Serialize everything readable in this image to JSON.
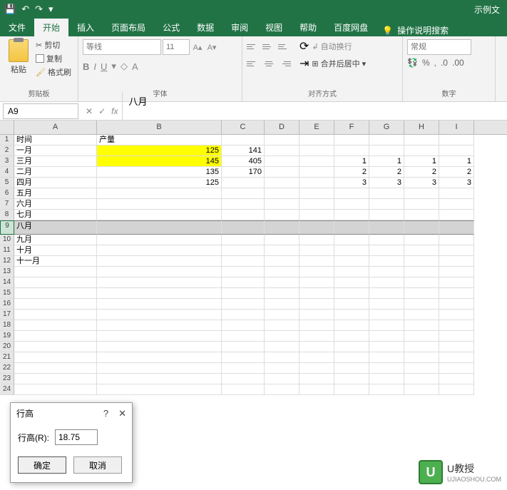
{
  "titlebar": {
    "title": "示例文"
  },
  "tabs": {
    "file": "文件",
    "home": "开始",
    "insert": "插入",
    "layout": "页面布局",
    "formulas": "公式",
    "data": "数据",
    "review": "审阅",
    "view": "视图",
    "help": "帮助",
    "baidu": "百度网盘",
    "tellme": "操作说明搜索"
  },
  "ribbon": {
    "clipboard": {
      "paste": "粘贴",
      "cut": "剪切",
      "copy": "复制",
      "format_painter": "格式刷",
      "label": "剪贴板"
    },
    "font": {
      "name_placeholder": "等线",
      "size_placeholder": "11",
      "label": "字体"
    },
    "align": {
      "wrap": "自动换行",
      "merge": "合并后居中",
      "label": "对齐方式"
    },
    "number": {
      "format": "常规",
      "label": "数字"
    }
  },
  "namebox": "A9",
  "formula_value": "八月",
  "columns": [
    "A",
    "B",
    "C",
    "D",
    "E",
    "F",
    "G",
    "H",
    "I"
  ],
  "rows": [
    {
      "n": 1,
      "A": "时间",
      "B": "产量"
    },
    {
      "n": 2,
      "A": "一月",
      "B": "125",
      "C": "141",
      "yellow": true
    },
    {
      "n": 3,
      "A": "三月",
      "B": "145",
      "C": "405",
      "F": "1",
      "G": "1",
      "H": "1",
      "I": "1",
      "yellow": true
    },
    {
      "n": 4,
      "A": "二月",
      "B": "135",
      "C": "170",
      "F": "2",
      "G": "2",
      "H": "2",
      "I": "2"
    },
    {
      "n": 5,
      "A": "四月",
      "B": "125",
      "F": "3",
      "G": "3",
      "H": "3",
      "I": "3"
    },
    {
      "n": 6,
      "A": "五月"
    },
    {
      "n": 7,
      "A": "六月"
    },
    {
      "n": 8,
      "A": "七月"
    },
    {
      "n": 9,
      "A": "八月",
      "selected": true
    },
    {
      "n": 10,
      "A": "九月"
    },
    {
      "n": 11,
      "A": "十月"
    },
    {
      "n": 12,
      "A": "十一月"
    },
    {
      "n": 13
    },
    {
      "n": 14
    },
    {
      "n": 15
    },
    {
      "n": 16
    },
    {
      "n": 17
    },
    {
      "n": 18
    },
    {
      "n": 19
    },
    {
      "n": 20
    },
    {
      "n": 21
    },
    {
      "n": 22
    },
    {
      "n": 23
    },
    {
      "n": 24
    }
  ],
  "dialog": {
    "title": "行高",
    "label": "行高(R):",
    "value": "18.75",
    "ok": "确定",
    "cancel": "取消"
  },
  "watermark": {
    "logo": "U",
    "name": "U教授",
    "url": "UJIAOSHOU.COM"
  }
}
